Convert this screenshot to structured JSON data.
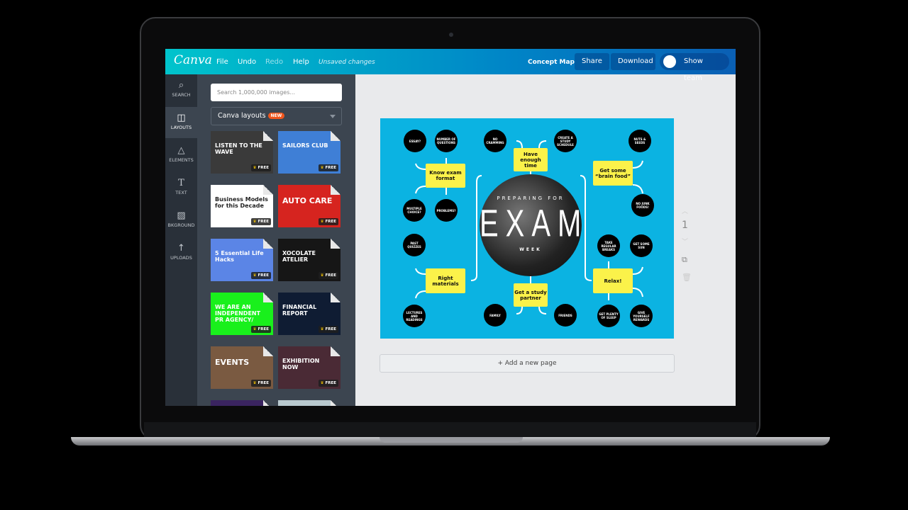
{
  "topbar": {
    "logo": "Canva",
    "file": "File",
    "undo": "Undo",
    "redo": "Redo",
    "help": "Help",
    "status": "Unsaved changes",
    "doc_title": "Concept Map",
    "share": "Share",
    "download": "Download",
    "show_team": "Show team"
  },
  "rail": [
    {
      "label": "SEARCH",
      "icon": "search-icon"
    },
    {
      "label": "LAYOUTS",
      "icon": "layouts-icon"
    },
    {
      "label": "ELEMENTS",
      "icon": "elements-icon"
    },
    {
      "label": "TEXT",
      "icon": "text-icon"
    },
    {
      "label": "BKGROUND",
      "icon": "background-icon"
    },
    {
      "label": "UPLOADS",
      "icon": "upload-icon"
    }
  ],
  "panel": {
    "search_placeholder": "Search 1,000,000 images...",
    "dropdown": "Canva layouts",
    "badge": "NEW",
    "free": "FREE",
    "templates": [
      {
        "text": "LISTEN TO THE WAVE",
        "bg": "#3a3a3a"
      },
      {
        "text": "SAILORS CLUB",
        "bg": "#3f7fd6"
      },
      {
        "text": "Business Models for this Decade",
        "bg": "#ffffff"
      },
      {
        "text": "AUTO CARE",
        "bg": "#d6241f"
      },
      {
        "text": "5 Essential Life Hacks",
        "bg": "#5b85e6"
      },
      {
        "text": "XOCOLATE ATELIER",
        "bg": "#161616"
      },
      {
        "text": "WE ARE AN INDEPENDENT PR AGENCY/",
        "bg": "#19f01c"
      },
      {
        "text": "FINANCIAL REPORT",
        "bg": "#0f1c33"
      },
      {
        "text": "EVENTS",
        "bg": "#7a5a41"
      },
      {
        "text": "EXHIBITION NOW",
        "bg": "#4a2a35"
      }
    ]
  },
  "design": {
    "title_top": "PREPARING FOR",
    "title_main": "EXAM",
    "title_bottom": "WEEK",
    "boxes": [
      "Know exam format",
      "Have enough time",
      "Get some “brain food”",
      "Right materials",
      "Get a study partner",
      "Relax!"
    ],
    "circles": [
      "ESSAY?",
      "NUMBER OF QUESTIONS",
      "NO CRAMMING",
      "CREATE A STUDY SCHEDULE",
      "NUTS & SEEDS",
      "NO JUNK FOODS!",
      "MULTIPLE CHOICE?",
      "PROBLEMS?",
      "PAST QUIZZES",
      "TAKE REGULAR BREAKS",
      "GET SOME SUN",
      "LECTURES AND READINGS",
      "FAMILY",
      "FRIENDS",
      "GET PLENTY OF SLEEP",
      "GIVE YOURSELF REWARDS"
    ],
    "background": "#0bb3e2",
    "box_color": "#fbf24a"
  },
  "page_number": "1",
  "add_page": "+ Add a new page"
}
